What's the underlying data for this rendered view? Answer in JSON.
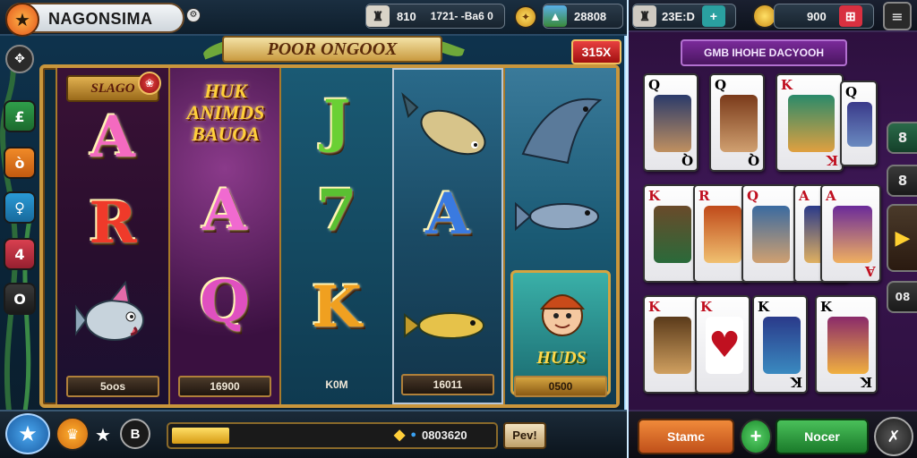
{
  "header": {
    "logo_text": "NAGONSIMA",
    "stat_a": "810",
    "stat_b": "1721- -Ba6 0",
    "coins": "28808",
    "right_credits": "23E:D",
    "right_coins": "900"
  },
  "machine": {
    "title": "POOR ONGOOX",
    "multiplier": "315X",
    "badge_label": "SLAGO",
    "promo_text": "HUK\nANIMDS\nBAUOA",
    "hero_label": "HUDS"
  },
  "reels": [
    {
      "symbols": [
        "A",
        "R",
        "fish"
      ],
      "label": "5oos"
    },
    {
      "symbols": [
        "promo",
        "A",
        "Q"
      ],
      "label": "16900"
    },
    {
      "symbols": [
        "J",
        "7",
        "K"
      ],
      "label": "K0M"
    },
    {
      "symbols": [
        "fish",
        "A",
        "fish"
      ],
      "label": "16011"
    },
    {
      "symbols": [
        "fish",
        "fish",
        "hero"
      ],
      "label": "0500"
    }
  ],
  "bottom": {
    "balance": "0803620",
    "bet_button": "Pev!",
    "progress_fraction": 0.18,
    "round_button": "B"
  },
  "right_panel": {
    "banner": "GMB IHOHE DACYOOH",
    "card_rows": [
      [
        "Q",
        "Q",
        "K",
        "Q"
      ],
      [
        "K",
        "R",
        "Q",
        "A",
        "A"
      ],
      [
        "K",
        "K",
        "K",
        "K"
      ]
    ],
    "side_buttons": [
      "8",
      "8",
      "▶",
      "08"
    ],
    "stamp_button": "Stamc",
    "plus_button": "+",
    "nocer_button": "Nocer"
  },
  "colors": {
    "accent_gold": "#c9963c",
    "panel_purple": "#3b1652",
    "stamp_orange": "#e36b1a",
    "nocer_green": "#2ea84a"
  }
}
